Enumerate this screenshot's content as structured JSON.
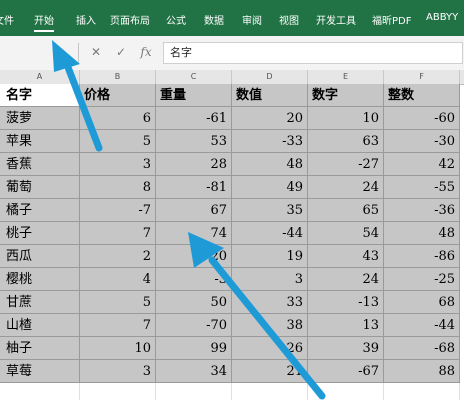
{
  "ribbon": {
    "tabs": [
      "文件",
      "开始",
      "插入",
      "页面布局",
      "公式",
      "数据",
      "审阅",
      "视图",
      "开发工具",
      "福昕PDF",
      "ABBYY"
    ],
    "active_tab": "开始",
    "color": "#217346"
  },
  "formula_bar": {
    "cancel_icon": "cancel-icon",
    "confirm_icon": "check-icon",
    "fx_label": "fx",
    "content": "名字"
  },
  "columns": [
    "A",
    "B",
    "C",
    "D",
    "E",
    "F"
  ],
  "table": {
    "headers": [
      "名字",
      "价格",
      "重量",
      "数值",
      "数字",
      "整数"
    ],
    "rows": [
      [
        "菠萝",
        "6",
        "-61",
        "20",
        "10",
        "-60"
      ],
      [
        "苹果",
        "5",
        "53",
        "-33",
        "63",
        "-30"
      ],
      [
        "香蕉",
        "3",
        "28",
        "48",
        "-27",
        "42"
      ],
      [
        "葡萄",
        "8",
        "-81",
        "49",
        "24",
        "-55"
      ],
      [
        "橘子",
        "-7",
        "67",
        "35",
        "65",
        "-36"
      ],
      [
        "桃子",
        "7",
        "74",
        "-44",
        "54",
        "48"
      ],
      [
        "西瓜",
        "2",
        "20",
        "19",
        "43",
        "-86"
      ],
      [
        "樱桃",
        "4",
        "-3",
        "3",
        "24",
        "-25"
      ],
      [
        "甘蔗",
        "5",
        "50",
        "33",
        "-13",
        "68"
      ],
      [
        "山楂",
        "7",
        "-70",
        "38",
        "13",
        "-44"
      ],
      [
        "柚子",
        "10",
        "99",
        "-26",
        "39",
        "-68"
      ],
      [
        "草莓",
        "3",
        "34",
        "21",
        "-67",
        "88"
      ]
    ],
    "selection_color": "#c6c6c6"
  },
  "annotations": {
    "arrow_color": "#1e9bd7"
  }
}
